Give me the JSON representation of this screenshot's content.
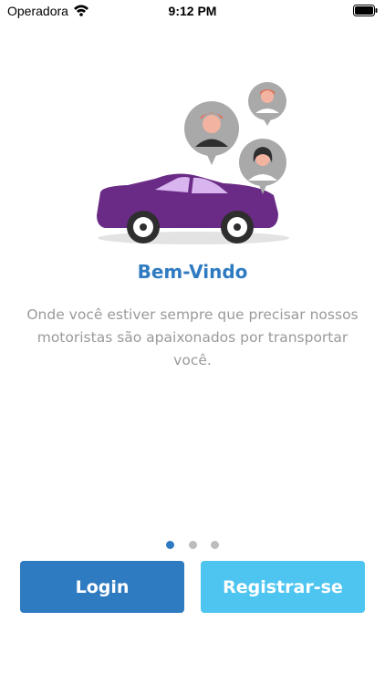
{
  "status_bar": {
    "carrier": "Operadora",
    "time": "9:12 PM"
  },
  "onboarding": {
    "title": "Bem-Vindo",
    "description": "Onde você estiver sempre que precisar nossos motoristas são apaixonados por transportar você.",
    "page_count": 3,
    "active_page": 1
  },
  "buttons": {
    "login": "Login",
    "register": "Registrar-se"
  },
  "colors": {
    "primary": "#2f7bc1",
    "secondary": "#4ec5f1",
    "car": "#6a2b86",
    "text_muted": "#9a9a9a"
  },
  "icons": [
    "wifi-icon",
    "battery-icon",
    "car-illustration",
    "driver-avatar-icon"
  ]
}
